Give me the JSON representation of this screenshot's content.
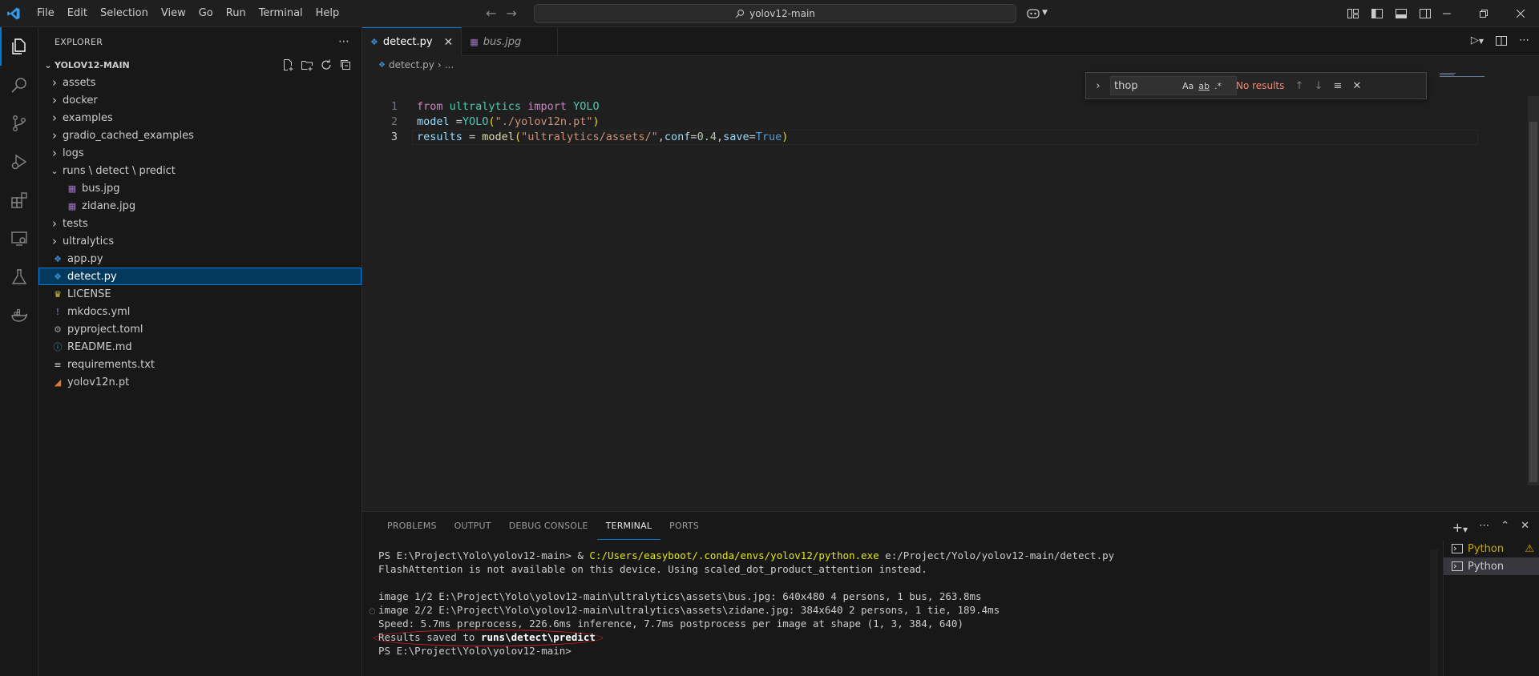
{
  "menu": [
    "File",
    "Edit",
    "Selection",
    "View",
    "Go",
    "Run",
    "Terminal",
    "Help"
  ],
  "command_center": {
    "text": "yolov12-main"
  },
  "explorer": {
    "header": "EXPLORER",
    "section": "YOLOV12-MAIN",
    "items": [
      {
        "label": "assets",
        "kind": "folder",
        "depth": 0,
        "expanded": false
      },
      {
        "label": "docker",
        "kind": "folder",
        "depth": 0,
        "expanded": false
      },
      {
        "label": "examples",
        "kind": "folder",
        "depth": 0,
        "expanded": false
      },
      {
        "label": "gradio_cached_examples",
        "kind": "folder",
        "depth": 0,
        "expanded": false
      },
      {
        "label": "logs",
        "kind": "folder",
        "depth": 0,
        "expanded": false
      },
      {
        "label": "runs \\ detect \\ predict",
        "kind": "folder",
        "depth": 0,
        "expanded": true
      },
      {
        "label": "bus.jpg",
        "kind": "image",
        "depth": 1
      },
      {
        "label": "zidane.jpg",
        "kind": "image",
        "depth": 1
      },
      {
        "label": "tests",
        "kind": "folder",
        "depth": 0,
        "expanded": false
      },
      {
        "label": "ultralytics",
        "kind": "folder",
        "depth": 0,
        "expanded": false
      },
      {
        "label": "app.py",
        "kind": "python",
        "depth": 0
      },
      {
        "label": "detect.py",
        "kind": "python",
        "depth": 0,
        "selected": true
      },
      {
        "label": "LICENSE",
        "kind": "license",
        "depth": 0
      },
      {
        "label": "mkdocs.yml",
        "kind": "yaml",
        "depth": 0
      },
      {
        "label": "pyproject.toml",
        "kind": "toml",
        "depth": 0
      },
      {
        "label": "README.md",
        "kind": "info",
        "depth": 0
      },
      {
        "label": "requirements.txt",
        "kind": "text",
        "depth": 0
      },
      {
        "label": "yolov12n.pt",
        "kind": "rss",
        "depth": 0
      }
    ]
  },
  "tabs": [
    {
      "label": "detect.py",
      "active": true
    },
    {
      "label": "bus.jpg",
      "active": false
    }
  ],
  "breadcrumb": {
    "file": "detect.py",
    "rest": "..."
  },
  "code": {
    "line_numbers": [
      "1",
      "2",
      "3"
    ],
    "l1": {
      "kw1": "from",
      "mod": "ultralytics",
      "kw2": "import",
      "cls": "YOLO"
    },
    "l2": {
      "var": "model",
      "op": " =",
      "fn": "YOLO",
      "arg": "\"./yolov12n.pt\""
    },
    "l3": {
      "var": "results",
      "op": " = ",
      "fn": "model",
      "arg": "\"ultralytics/assets/\"",
      "k1": "conf",
      "v1": "0.4",
      "k2": "save",
      "v2": "True"
    }
  },
  "find": {
    "value": "thop",
    "result": "No results",
    "opt_case": "Aa",
    "opt_word": "ab",
    "opt_regex": ".*"
  },
  "panel": {
    "tabs": [
      "PROBLEMS",
      "OUTPUT",
      "DEBUG CONSOLE",
      "TERMINAL",
      "PORTS"
    ],
    "active_tab": "TERMINAL",
    "terminal": {
      "l1_prompt": "PS E:\\Project\\Yolo\\yolov12-main> & ",
      "l1_exe": "C:/Users/easyboot/.conda/envs/yolov12/python.exe",
      "l1_arg": " e:/Project/Yolo/yolov12-main/detect.py",
      "l2": "FlashAttention is not available on this device. Using scaled_dot_product_attention instead.",
      "l3": "",
      "l4": "image 1/2 E:\\Project\\Yolo\\yolov12-main\\ultralytics\\assets\\bus.jpg: 640x480 4 persons, 1 bus, 263.8ms",
      "l5": "image 2/2 E:\\Project\\Yolo\\yolov12-main\\ultralytics\\assets\\zidane.jpg: 384x640 2 persons, 1 tie, 189.4ms",
      "l6": "Speed: 5.7ms preprocess, 226.6ms inference, 7.7ms postprocess per image at shape (1, 3, 384, 640)",
      "l7_pre": "Results saved to ",
      "l7_path": "runs\\detect\\predict",
      "l8": "PS E:\\Project\\Yolo\\yolov12-main>"
    },
    "terminals": [
      "Python",
      "Python"
    ]
  },
  "colors": {
    "accent": "#0078d4",
    "error": "#f48771",
    "warning": "#cca700"
  }
}
